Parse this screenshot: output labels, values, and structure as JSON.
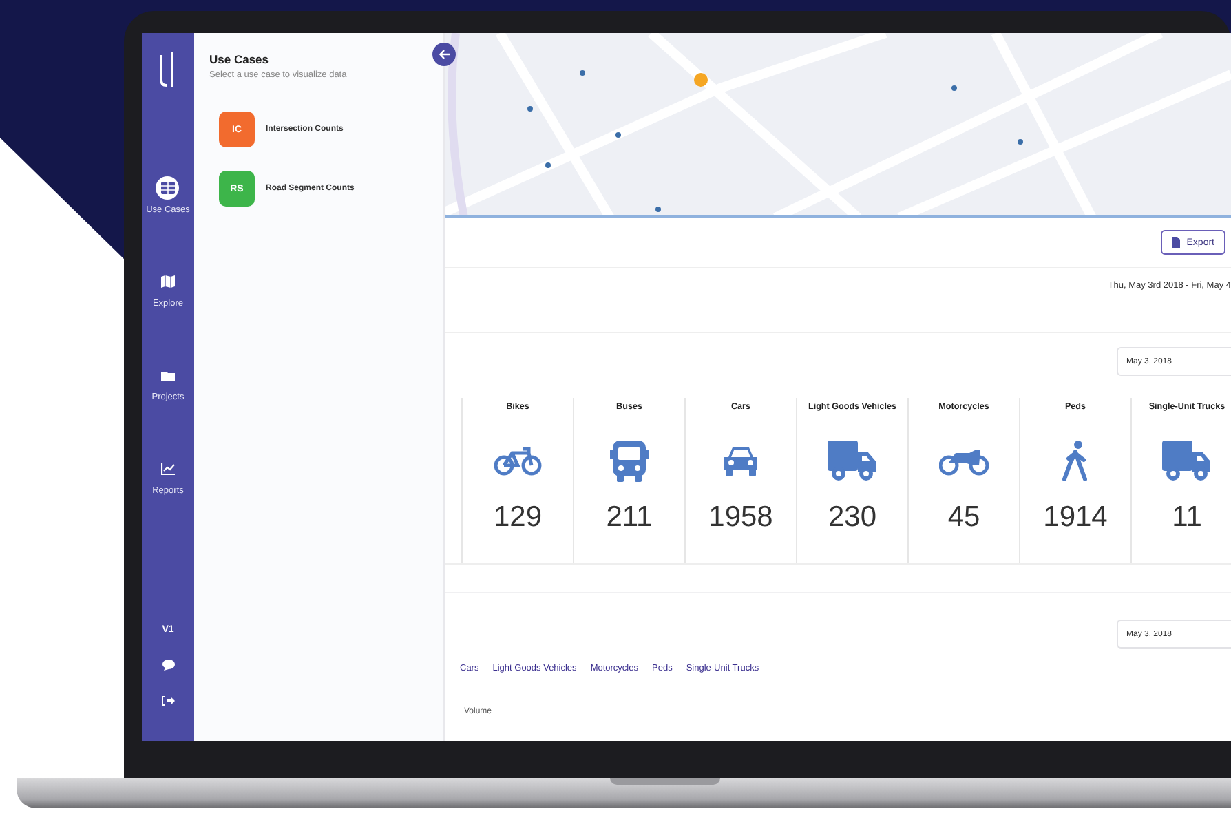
{
  "sidebar": {
    "items": [
      {
        "label": "Use Cases",
        "kind": "grid",
        "selected": true
      },
      {
        "label": "Explore",
        "kind": "map",
        "selected": false
      },
      {
        "label": "Projects",
        "kind": "folder",
        "selected": false
      },
      {
        "label": "Reports",
        "kind": "chart",
        "selected": false
      }
    ],
    "version": "V1"
  },
  "panel": {
    "title": "Use Cases",
    "subtitle": "Select a use case to visualize data",
    "use_cases": [
      {
        "badge": "IC",
        "label": "Intersection Counts",
        "color": "#f26b2e"
      },
      {
        "badge": "RS",
        "label": "Road Segment Counts",
        "color": "#3db54a"
      }
    ]
  },
  "toolbar": {
    "export_label": "Export"
  },
  "date_range": "Thu, May 3rd 2018 - Fri, May 4",
  "summary": {
    "date": "May 3, 2018",
    "counts": [
      {
        "label": "Bikes",
        "kind": "bike",
        "value": "129"
      },
      {
        "label": "Buses",
        "kind": "bus",
        "value": "211"
      },
      {
        "label": "Cars",
        "kind": "car",
        "value": "1958"
      },
      {
        "label": "Light Goods Vehicles",
        "kind": "truck",
        "value": "230"
      },
      {
        "label": "Motorcycles",
        "kind": "motorcycle",
        "value": "45"
      },
      {
        "label": "Peds",
        "kind": "walker",
        "value": "1914"
      },
      {
        "label": "Single-Unit Trucks",
        "kind": "truck",
        "value": "11"
      }
    ]
  },
  "chart_section": {
    "date": "May 3, 2018",
    "legend": [
      "Cars",
      "Light Goods Vehicles",
      "Motorcycles",
      "Peds",
      "Single-Unit Trucks"
    ],
    "y_label": "Volume"
  }
}
